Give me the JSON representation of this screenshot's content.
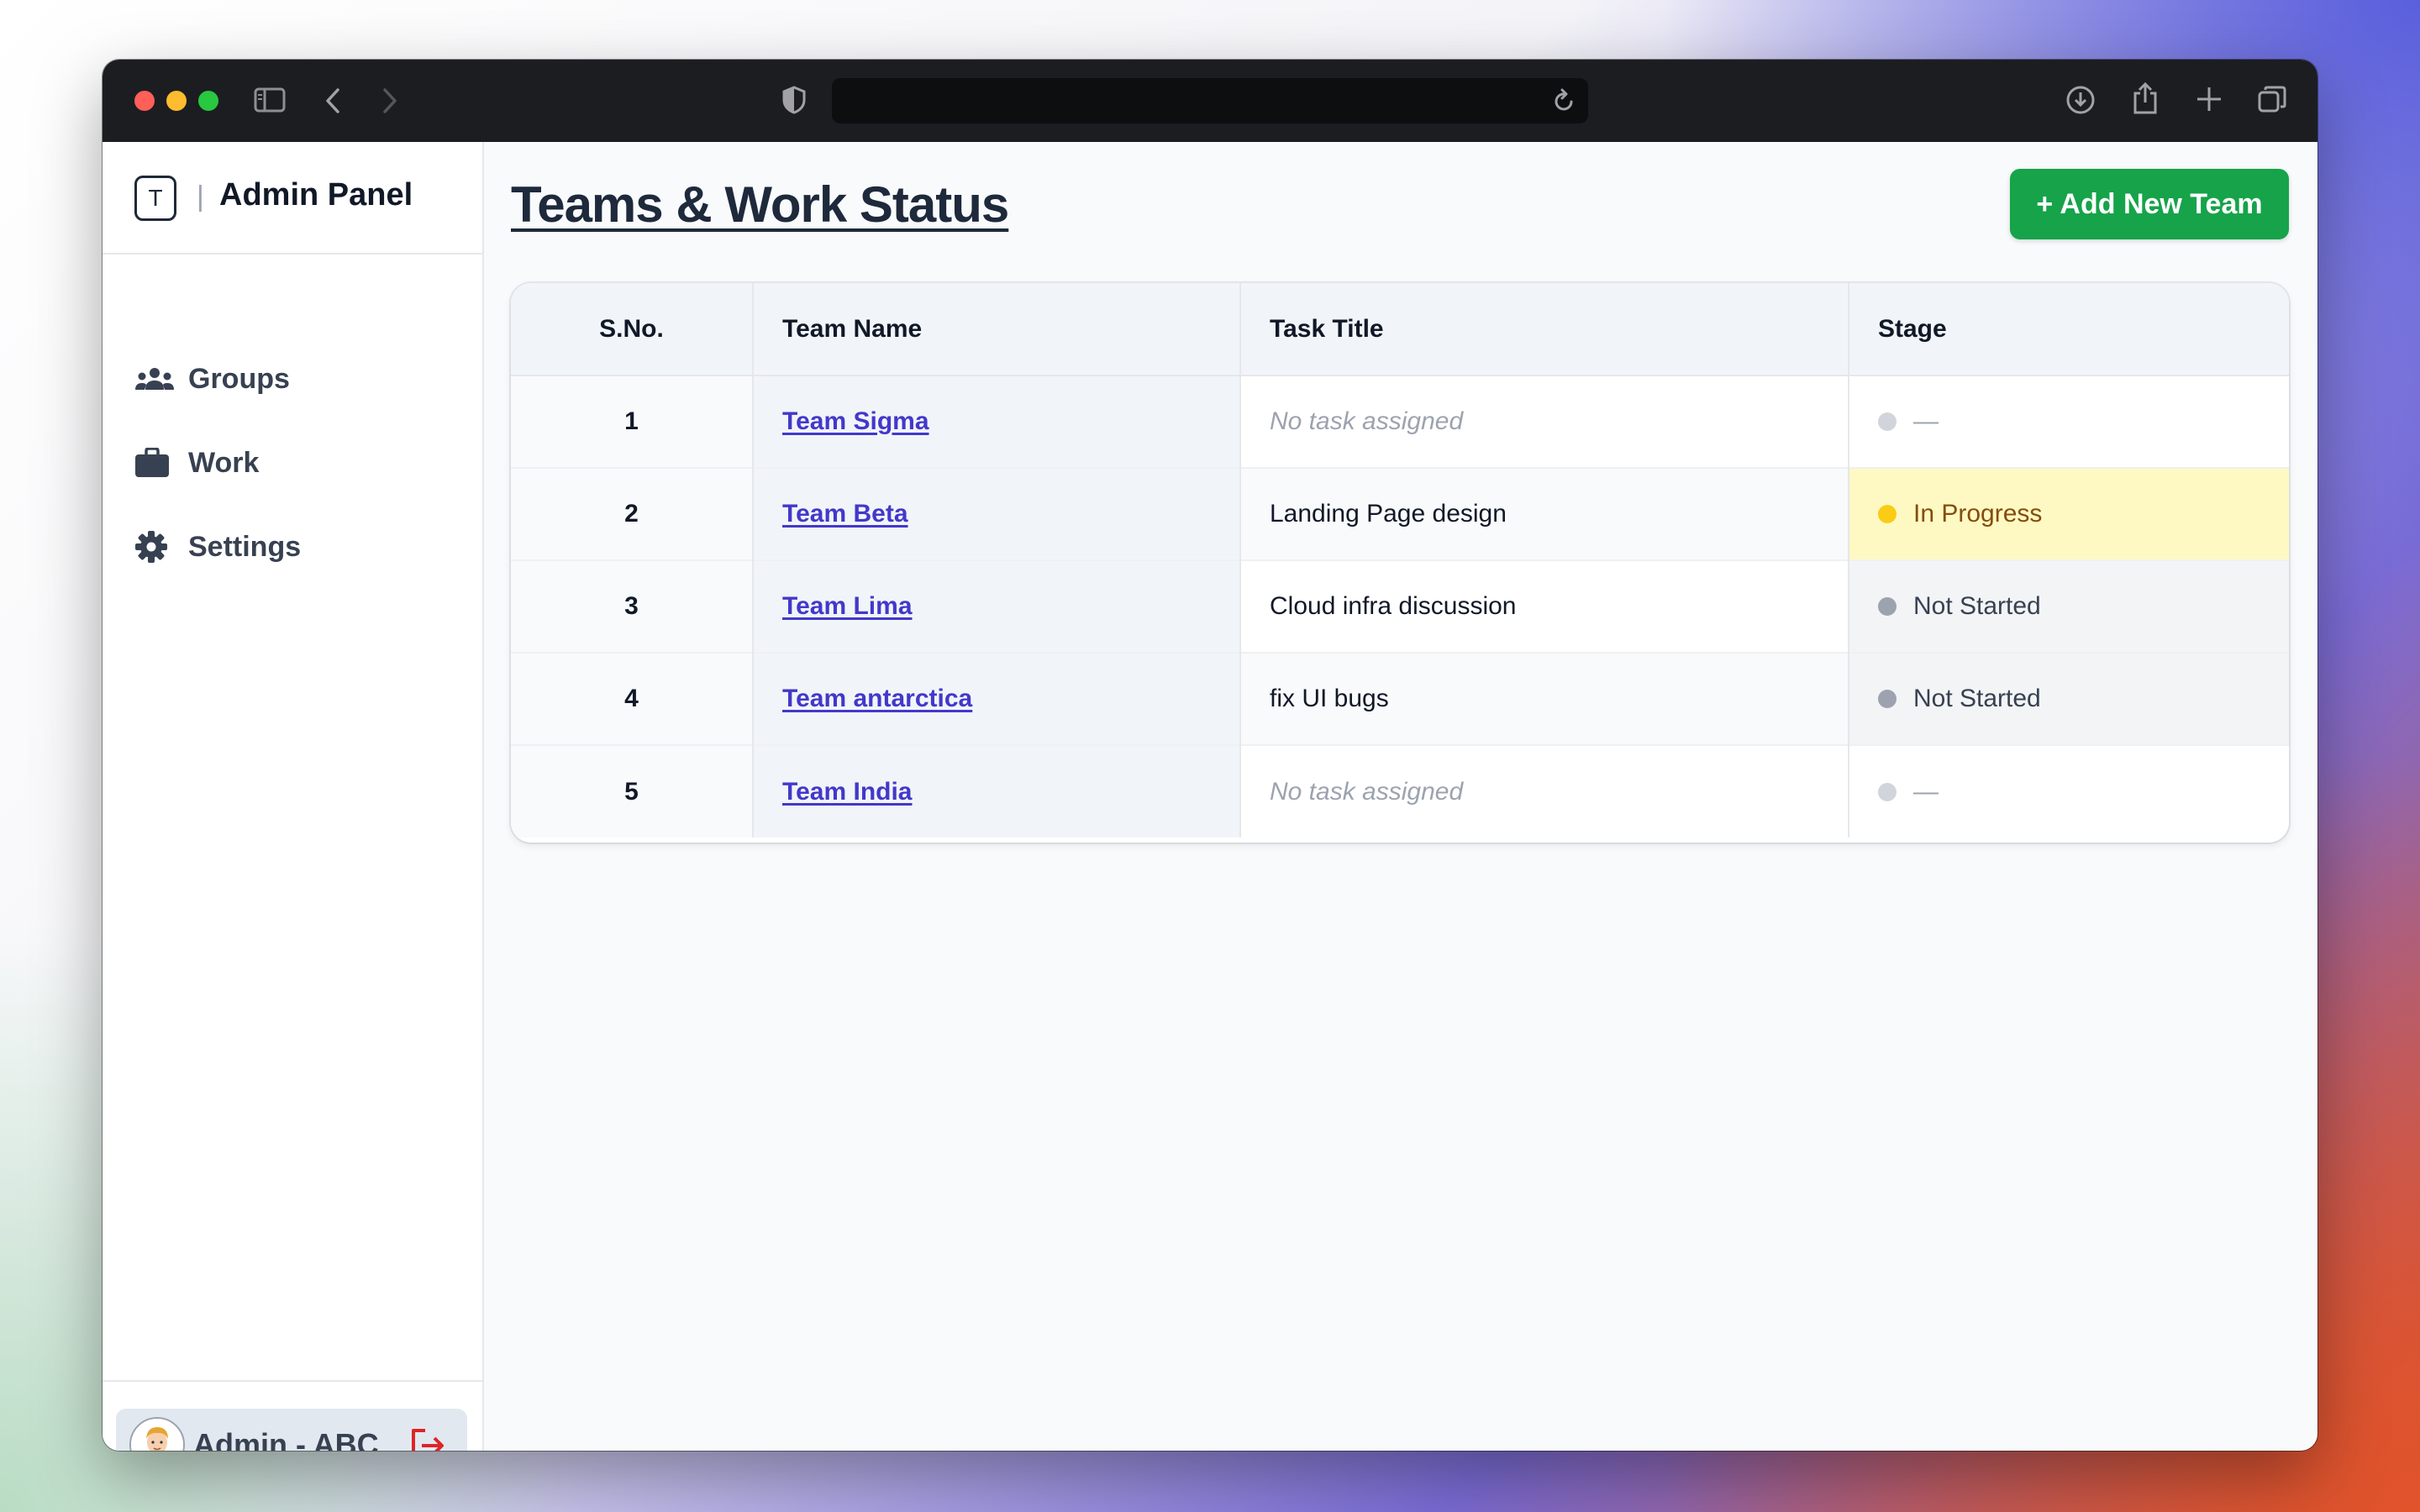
{
  "browser": {
    "address": ""
  },
  "sidebar": {
    "brand_logo_letter": "T",
    "brand_separator": "|",
    "brand_title": "Admin Panel",
    "items": [
      {
        "label": "Groups",
        "icon": "users-icon"
      },
      {
        "label": "Work",
        "icon": "briefcase-icon"
      },
      {
        "label": "Settings",
        "icon": "gear-icon"
      }
    ],
    "user": {
      "name": "Admin - ABC",
      "avatar_icon": "avatar-icon",
      "logout_icon": "logout-icon"
    }
  },
  "main": {
    "title": "Teams & Work Status",
    "add_button": "+ Add New Team",
    "table": {
      "headers": [
        "S.No.",
        "Team Name",
        "Task Title",
        "Stage"
      ],
      "rows": [
        {
          "sno": "1",
          "team": "Team Sigma",
          "task": "No task assigned",
          "stage": "—"
        },
        {
          "sno": "2",
          "team": "Team Beta",
          "task": "Landing Page design",
          "stage": "In Progress"
        },
        {
          "sno": "3",
          "team": "Team Lima",
          "task": "Cloud infra discussion",
          "stage": "Not Started"
        },
        {
          "sno": "4",
          "team": "Team antarctica",
          "task": "fix UI bugs",
          "stage": "Not Started"
        },
        {
          "sno": "5",
          "team": "Team India",
          "task": "No task assigned",
          "stage": "—"
        }
      ]
    }
  },
  "colors": {
    "accent_green": "#16a34a",
    "link": "#4338ca",
    "in_progress": "#facc15",
    "not_started": "#9ca3af"
  }
}
